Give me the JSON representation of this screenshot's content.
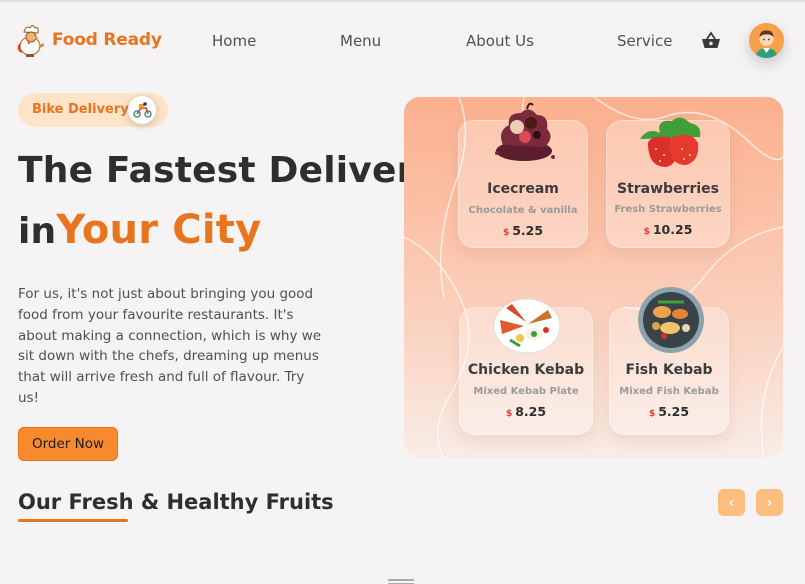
{
  "brand": {
    "name": "Food Ready",
    "logo": "rooster-chef-logo"
  },
  "nav": {
    "items": [
      {
        "label": "Home"
      },
      {
        "label": "Menu"
      },
      {
        "label": "About Us"
      },
      {
        "label": "Service"
      }
    ],
    "cart_icon": "basket-icon",
    "avatar_icon": "user-avatar"
  },
  "hero": {
    "badge": {
      "label": "Bike Delivery",
      "icon": "delivery-scooter-icon"
    },
    "headline_line1": "The Fastest Delivery",
    "headline_in": "in",
    "headline_accent": "Your City",
    "description": "For us, it's not just about bringing you good food from your favourite restaurants. It's about making a connection, which is why we sit down with the chefs, dreaming up menus that will arrive fresh and full of flavour. Try us!",
    "cta_label": "Order Now"
  },
  "food_items": [
    {
      "name": "Icecream",
      "description": "Chocolate & vanilla",
      "currency": "$",
      "price": "5.25"
    },
    {
      "name": "Strawberries",
      "description": "Fresh Strawberries",
      "currency": "$",
      "price": "10.25"
    },
    {
      "name": "Chicken Kebab",
      "description": "Mixed Kebab Plate",
      "currency": "$",
      "price": "8.25"
    },
    {
      "name": "Fish Kebab",
      "description": "Mixed Fish Kebab",
      "currency": "$",
      "price": "5.25"
    }
  ],
  "fruits_section": {
    "title": "Our Fresh & Healthy Fruits",
    "prev_label": "‹",
    "next_label": "›"
  },
  "colors": {
    "accent": "#e8741e",
    "button": "#f68a2c",
    "arrow_button": "#fcbd7e",
    "badge_bg": "#fde4c8",
    "price_currency": "#e33b3b",
    "page_bg": "#f5f3f3"
  }
}
